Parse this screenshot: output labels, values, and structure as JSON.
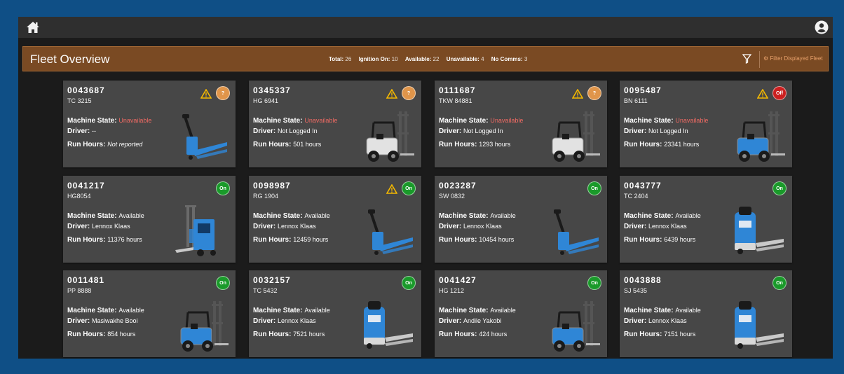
{
  "app": {
    "user_icon": "user-circle-icon",
    "home_icon": "home-icon"
  },
  "header": {
    "title": "Fleet Overview",
    "stats": [
      {
        "label": "Total:",
        "value": "26"
      },
      {
        "label": "Ignition On:",
        "value": "10"
      },
      {
        "label": "Available:",
        "value": "22"
      },
      {
        "label": "Unavailable:",
        "value": "4"
      },
      {
        "label": "No Comms:",
        "value": "3"
      }
    ],
    "filter_button": "Filter Displayed Fleet"
  },
  "labels": {
    "machine_state": "Machine State:",
    "driver": "Driver:",
    "run_hours": "Run Hours:"
  },
  "colors": {
    "unavailable": "#ef6a63",
    "badge_unknown": "#e0954a",
    "badge_off": "#cc1f1f",
    "badge_on": "#1a9a2a",
    "warning": "#f4b800"
  },
  "cards": [
    {
      "id": "0043687",
      "plate": "TC 3215",
      "state": "Unavailable",
      "driver": "--",
      "hours": "Not reported",
      "warning": true,
      "badge": "?",
      "badge_type": "unknown",
      "vehicle": "pallet-truck"
    },
    {
      "id": "0345337",
      "plate": "HG 6941",
      "state": "Unavailable",
      "driver": "Not Logged In",
      "hours": "501 hours",
      "warning": true,
      "badge": "?",
      "badge_type": "unknown",
      "vehicle": "counterbalance-white"
    },
    {
      "id": "0111687",
      "plate": "TKW 84881",
      "state": "Unavailable",
      "driver": "Not Logged In",
      "hours": "1293 hours",
      "warning": true,
      "badge": "?",
      "badge_type": "unknown",
      "vehicle": "counterbalance-white"
    },
    {
      "id": "0095487",
      "plate": "BN 6111",
      "state": "Unavailable",
      "driver": "Not Logged In",
      "hours": "23341 hours",
      "warning": true,
      "badge": "Off",
      "badge_type": "off",
      "vehicle": "counterbalance-blue"
    },
    {
      "id": "0041217",
      "plate": "HG8054",
      "state": "Available",
      "driver": "Lennox Klaas",
      "hours": "11376 hours",
      "warning": false,
      "badge": "On",
      "badge_type": "on",
      "vehicle": "reach-truck"
    },
    {
      "id": "0098987",
      "plate": "RG 1904",
      "state": "Available",
      "driver": "Lennox Klaas",
      "hours": "12459 hours",
      "warning": true,
      "badge": "On",
      "badge_type": "on",
      "vehicle": "pallet-truck"
    },
    {
      "id": "0023287",
      "plate": "SW 0832",
      "state": "Available",
      "driver": "Lennox Klaas",
      "hours": "10454 hours",
      "warning": false,
      "badge": "On",
      "badge_type": "on",
      "vehicle": "pallet-truck"
    },
    {
      "id": "0043777",
      "plate": "TC 2404",
      "state": "Available",
      "driver": "Lennox Klaas",
      "hours": "6439 hours",
      "warning": false,
      "badge": "On",
      "badge_type": "on",
      "vehicle": "tow-tractor"
    },
    {
      "id": "0011481",
      "plate": "PP 8888",
      "state": "Available",
      "driver": "Masiwakhe Booi",
      "hours": "854 hours",
      "warning": false,
      "badge": "On",
      "badge_type": "on",
      "vehicle": "counterbalance-blue"
    },
    {
      "id": "0032157",
      "plate": "TC 5432",
      "state": "Available",
      "driver": "Lennox Klaas",
      "hours": "7521 hours",
      "warning": false,
      "badge": "On",
      "badge_type": "on",
      "vehicle": "tow-tractor"
    },
    {
      "id": "0041427",
      "plate": "HG 1212",
      "state": "Available",
      "driver": "Andile Yakobi",
      "hours": "424 hours",
      "warning": false,
      "badge": "On",
      "badge_type": "on",
      "vehicle": "counterbalance-blue"
    },
    {
      "id": "0043888",
      "plate": "SJ 5435",
      "state": "Available",
      "driver": "Lennox Klaas",
      "hours": "7151 hours",
      "warning": false,
      "badge": "On",
      "badge_type": "on",
      "vehicle": "tow-tractor"
    }
  ]
}
